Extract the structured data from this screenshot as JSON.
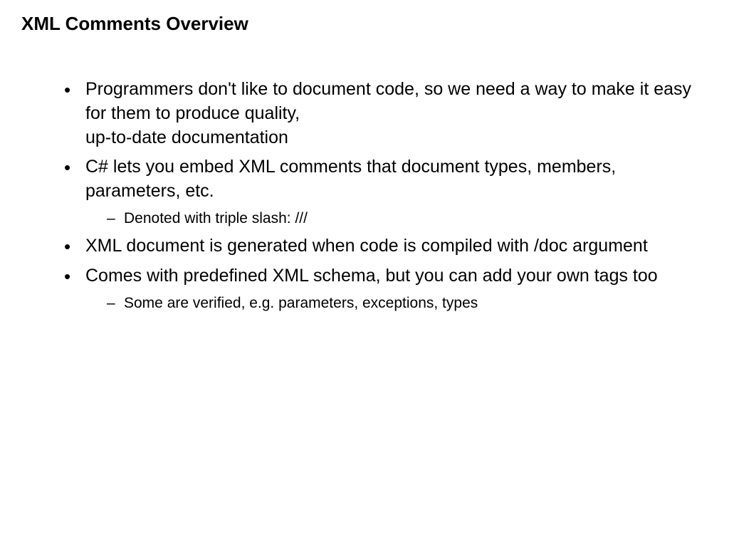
{
  "title": "XML Comments Overview",
  "bullets": [
    {
      "text_line1": "Programmers don't like to document code, so we need a way to make it easy for them to produce quality,",
      "text_line2": "up-to-date documentation",
      "sub": []
    },
    {
      "text_line1": "C# lets you embed XML comments that document types, members, parameters, etc.",
      "text_line2": "",
      "sub": [
        "Denoted with triple slash: ///"
      ]
    },
    {
      "text_line1": "XML document is generated when code is compiled with /doc argument",
      "text_line2": "",
      "sub": []
    },
    {
      "text_line1": "Comes with predefined XML schema, but you can add your own tags too",
      "text_line2": "",
      "sub": [
        "Some are verified, e.g. parameters, exceptions, types"
      ]
    }
  ]
}
